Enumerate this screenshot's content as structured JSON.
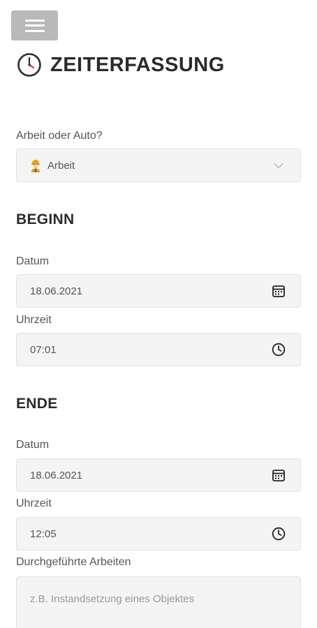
{
  "header": {
    "menu_icon": "hamburger-menu-icon",
    "title": "ZEITERFASSUNG",
    "title_icon": "clock-icon"
  },
  "type_select": {
    "label": "Arbeit oder Auto?",
    "value": "Arbeit",
    "value_icon": "worker-icon",
    "arrow_icon": "chevron-down-icon"
  },
  "beginn": {
    "heading": "BEGINN",
    "date_label": "Datum",
    "date_value": "18.06.2021",
    "date_icon": "calendar-icon",
    "time_label": "Uhrzeit",
    "time_value": "07:01",
    "time_icon": "clock-icon"
  },
  "ende": {
    "heading": "ENDE",
    "date_label": "Datum",
    "date_value": "18.06.2021",
    "date_icon": "calendar-icon",
    "time_label": "Uhrzeit",
    "time_value": "12:05",
    "time_icon": "clock-icon"
  },
  "arbeiten": {
    "label": "Durchgeführte Arbeiten",
    "placeholder": "z.B. Instandsetzung eines Objektes"
  },
  "colors": {
    "menu_button": "#b9b9b9",
    "field_background": "#f4f4f4",
    "clock_hand": "#d0312d"
  }
}
